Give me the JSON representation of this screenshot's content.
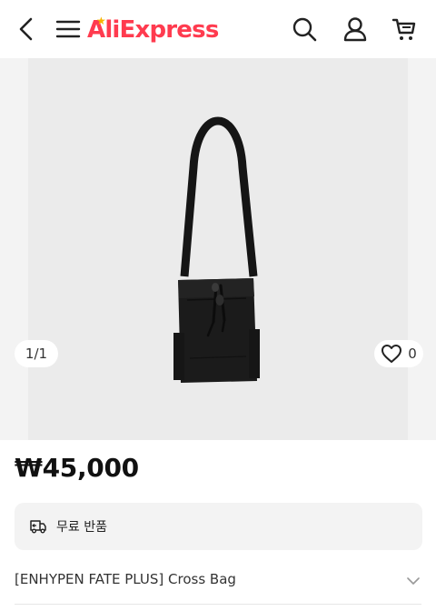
{
  "header": {
    "brand": "AliExpress",
    "icons": [
      "back-icon",
      "menu-icon",
      "search-icon",
      "user-icon",
      "cart-icon"
    ],
    "brand_color": "#ff3b4f"
  },
  "gallery": {
    "counter": "1/1",
    "wishlist_count": "0"
  },
  "product": {
    "price": "₩45,000",
    "benefit": "무료 반품",
    "title": "[ENHYPEN FATE PLUS] Cross Bag"
  }
}
